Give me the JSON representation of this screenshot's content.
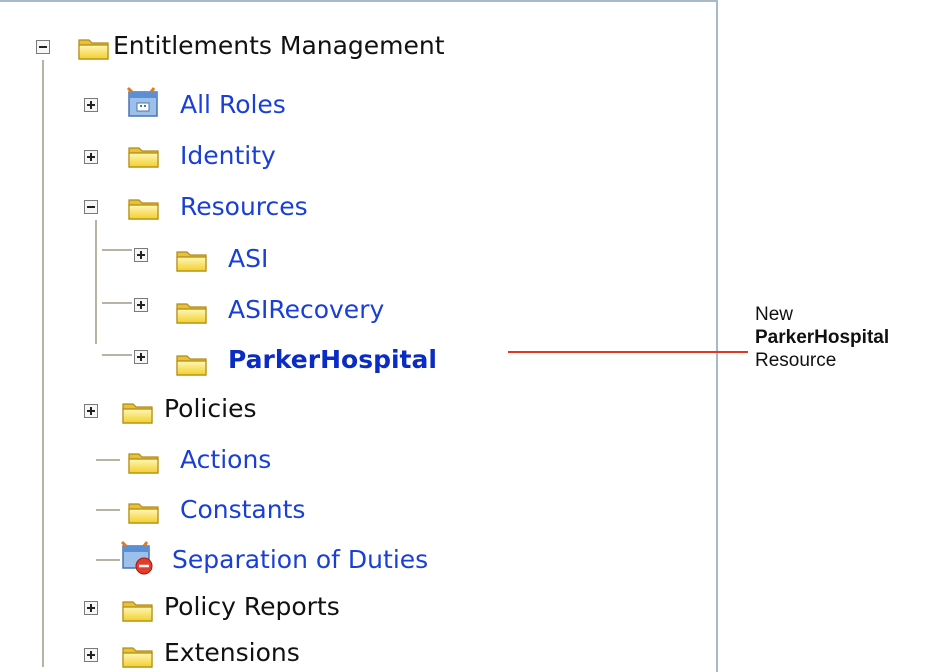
{
  "tree": {
    "root": {
      "label": "Entitlements Management",
      "icon": "folder-icon",
      "expanded": true
    },
    "items": [
      {
        "label": "All Roles",
        "icon": "roles-icon"
      },
      {
        "label": "Identity",
        "icon": "folder-icon"
      },
      {
        "label": "Resources",
        "icon": "folder-icon"
      },
      {
        "label": "ASI",
        "icon": "folder-icon"
      },
      {
        "label": "ASIRecovery",
        "icon": "folder-icon"
      },
      {
        "label": "ParkerHospital",
        "icon": "folder-icon"
      },
      {
        "label": "Policies",
        "icon": "folder-icon"
      },
      {
        "label": "Actions",
        "icon": "folder-icon"
      },
      {
        "label": "Constants",
        "icon": "folder-icon"
      },
      {
        "label": "Separation of Duties",
        "icon": "separation-icon"
      },
      {
        "label": "Policy Reports",
        "icon": "folder-icon"
      },
      {
        "label": "Extensions",
        "icon": "folder-icon"
      }
    ]
  },
  "callout": {
    "line1": "New",
    "line2": "ParkerHospital",
    "line3": "Resource"
  },
  "colors": {
    "link": "#1a3fd6",
    "callout_line": "#e0391f",
    "folder": "#f7d94c"
  }
}
